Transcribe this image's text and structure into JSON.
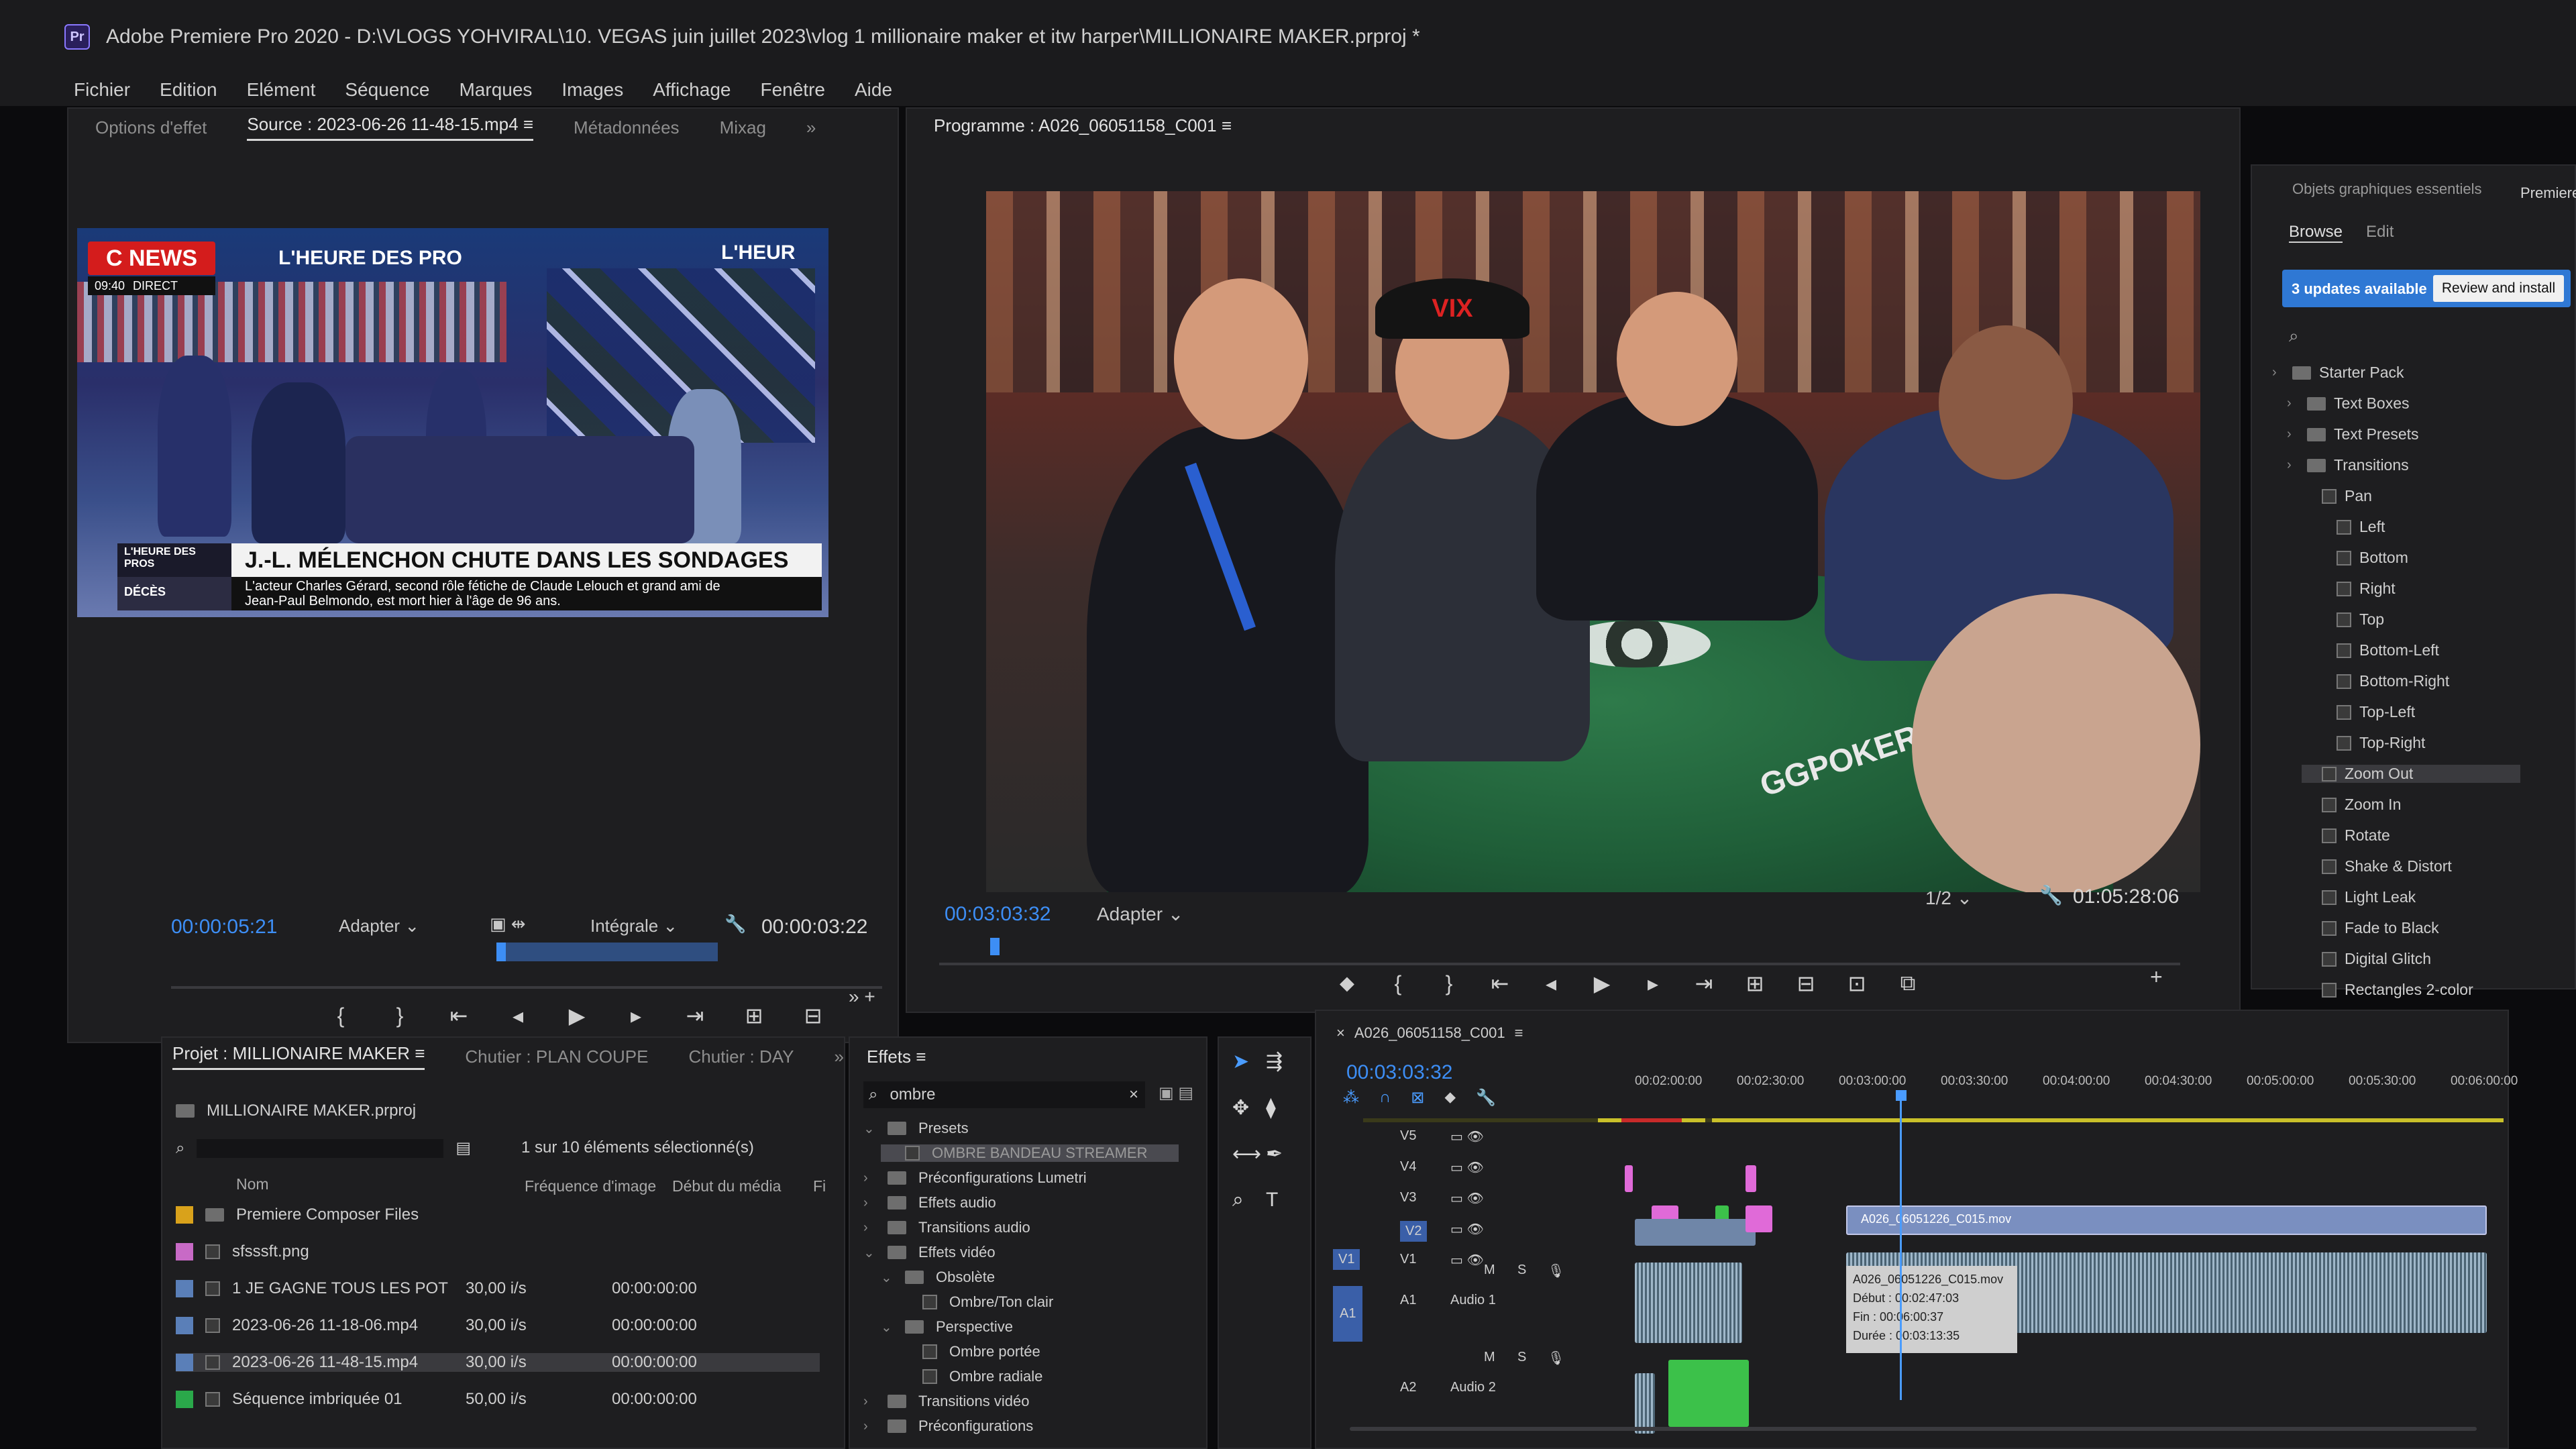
{
  "window": {
    "title": "Adobe Premiere Pro 2020 - D:\\VLOGS YOHVIRAL\\10. VEGAS juin juillet 2023\\vlog 1 millionaire maker et itw harper\\MILLIONAIRE MAKER.prproj *",
    "icon_letters": "Pr"
  },
  "menu": [
    "Fichier",
    "Edition",
    "Elément",
    "Séquence",
    "Marques",
    "Images",
    "Affichage",
    "Fenêtre",
    "Aide"
  ],
  "source_panel": {
    "tabs": [
      "Options d'effet",
      "Source : 2023-06-26 11-48-15.mp4",
      "Métadonnées",
      "Mixag"
    ],
    "menu_icon": "≡",
    "overflow": "»",
    "timecode_in": "00:00:05:21",
    "fit": "Adapter",
    "playback": "Intégrale",
    "timecode_duration": "00:00:03:22",
    "video": {
      "logo": "C NEWS",
      "live_time": "09:40",
      "live_label": "DIRECT",
      "header": "L'HEURE DES PRO",
      "header_right": "L'HEUR",
      "tag": "L'HEURE DES PROS",
      "headline": "J.-L. MÉLENCHON CHUTE DANS LES SONDAGES",
      "sub_label": "DÉCÈS",
      "subtitle_1": "L'acteur Charles Gérard, second rôle fétiche de Claude Lelouch et grand ami de",
      "subtitle_2": "Jean-Paul Belmondo, est mort hier à l'âge de 96 ans."
    }
  },
  "program_panel": {
    "title": "Programme : A026_06051158_C001",
    "menu_icon": "≡",
    "timecode": "00:03:03:32",
    "fit": "Adapter",
    "resolution": "1/2",
    "duration": "01:05:28:06",
    "table_logo": "GGPOKER",
    "cap_text": "VIX"
  },
  "essential_graphics": {
    "title": "Objets graphiques essentiels",
    "title_right": "Premiere",
    "tabs": [
      "Browse",
      "Edit"
    ],
    "updates": "3 updates available",
    "review_button": "Review and install",
    "items": [
      {
        "label": "Starter Pack",
        "kind": "folder",
        "indent": 0
      },
      {
        "label": "Text Boxes",
        "kind": "folder",
        "indent": 1
      },
      {
        "label": "Text Presets",
        "kind": "folder",
        "indent": 1
      },
      {
        "label": "Transitions",
        "kind": "folder",
        "indent": 1
      },
      {
        "label": "Pan",
        "kind": "box",
        "indent": 2
      },
      {
        "label": "Left",
        "kind": "box",
        "indent": 3
      },
      {
        "label": "Bottom",
        "kind": "box",
        "indent": 3
      },
      {
        "label": "Right",
        "kind": "box",
        "indent": 3
      },
      {
        "label": "Top",
        "kind": "box",
        "indent": 3
      },
      {
        "label": "Bottom-Left",
        "kind": "box",
        "indent": 3
      },
      {
        "label": "Bottom-Right",
        "kind": "box",
        "indent": 3
      },
      {
        "label": "Top-Left",
        "kind": "box",
        "indent": 3
      },
      {
        "label": "Top-Right",
        "kind": "box",
        "indent": 3
      },
      {
        "label": "Zoom Out",
        "kind": "box",
        "indent": 2
      },
      {
        "label": "Zoom In",
        "kind": "box",
        "indent": 2
      },
      {
        "label": "Rotate",
        "kind": "box",
        "indent": 2
      },
      {
        "label": "Shake & Distort",
        "kind": "box",
        "indent": 2
      },
      {
        "label": "Light Leak",
        "kind": "box",
        "indent": 2
      },
      {
        "label": "Fade to Black",
        "kind": "box",
        "indent": 2
      },
      {
        "label": "Digital Glitch",
        "kind": "box",
        "indent": 2
      },
      {
        "label": "Rectangles 2-color",
        "kind": "box",
        "indent": 2
      }
    ]
  },
  "project_panel": {
    "tabs": [
      "Projet : MILLIONAIRE MAKER",
      "Chutier : PLAN COUPE",
      "Chutier : DAY"
    ],
    "menu_icon": "≡",
    "overflow": "»",
    "project_file": "MILLIONAIRE MAKER.prproj",
    "selection": "1 sur 10 éléments sélectionné(s)",
    "columns": [
      "Nom",
      "Fréquence d'image",
      "Début du média",
      "Fi"
    ],
    "rows": [
      {
        "name": "Premiere Composer Files",
        "fps": "",
        "start": "",
        "color": "#d9a21b"
      },
      {
        "name": "sfsssft.png",
        "fps": "",
        "start": "",
        "color": "#c86ac6"
      },
      {
        "name": "1 JE GAGNE TOUS LES POT",
        "fps": "30,00 i/s",
        "start": "00:00:00:00",
        "color": "#5a7fb8"
      },
      {
        "name": "2023-06-26 11-18-06.mp4",
        "fps": "30,00 i/s",
        "start": "00:00:00:00",
        "color": "#5a7fb8"
      },
      {
        "name": "2023-06-26 11-48-15.mp4",
        "fps": "30,00 i/s",
        "start": "00:00:00:00",
        "color": "#5a7fb8"
      },
      {
        "name": "Séquence imbriquée 01",
        "fps": "50,00 i/s",
        "start": "00:00:00:00",
        "color": "#2aa84a"
      }
    ]
  },
  "effects_panel": {
    "title": "Effets",
    "menu_icon": "≡",
    "search": "ombre",
    "tree": [
      {
        "label": "Presets",
        "indent": 0,
        "open": true
      },
      {
        "label": "OMBRE BANDEAU STREAMER",
        "indent": 1,
        "selected": true
      },
      {
        "label": "Préconfigurations Lumetri",
        "indent": 0
      },
      {
        "label": "Effets audio",
        "indent": 0
      },
      {
        "label": "Transitions audio",
        "indent": 0
      },
      {
        "label": "Effets vidéo",
        "indent": 0,
        "open": true
      },
      {
        "label": "Obsolète",
        "indent": 1,
        "open": true
      },
      {
        "label": "Ombre/Ton clair",
        "indent": 2
      },
      {
        "label": "Perspective",
        "indent": 1,
        "open": true
      },
      {
        "label": "Ombre portée",
        "indent": 2
      },
      {
        "label": "Ombre radiale",
        "indent": 2
      },
      {
        "label": "Transitions vidéo",
        "indent": 0
      },
      {
        "label": "Préconfigurations",
        "indent": 0
      }
    ]
  },
  "timeline": {
    "sequence": "A026_06051158_C001",
    "close_icon": "×",
    "menu_icon": "≡",
    "timecode": "00:03:03:32",
    "ruler": [
      "00:02:00:00",
      "00:02:30:00",
      "00:03:00:00",
      "00:03:30:00",
      "00:04:00:00",
      "00:04:30:00",
      "00:05:00:00",
      "00:05:30:00",
      "00:06:00:00"
    ],
    "video_tracks": [
      "V5",
      "V4",
      "V3",
      "V2",
      "V1"
    ],
    "audio_tracks": [
      {
        "id": "A1",
        "name": "Audio 1"
      },
      {
        "id": "A2",
        "name": "Audio 2"
      }
    ],
    "toggles": {
      "mute": "M",
      "solo": "S"
    },
    "clip_label": "A026_06051226_C015.mov",
    "tooltip": {
      "name": "A026_06051226_C015.mov",
      "start": "Début : 00:02:47:03",
      "end": "Fin : 00:06:00:37",
      "duration": "Durée : 00:03:13:35"
    }
  }
}
